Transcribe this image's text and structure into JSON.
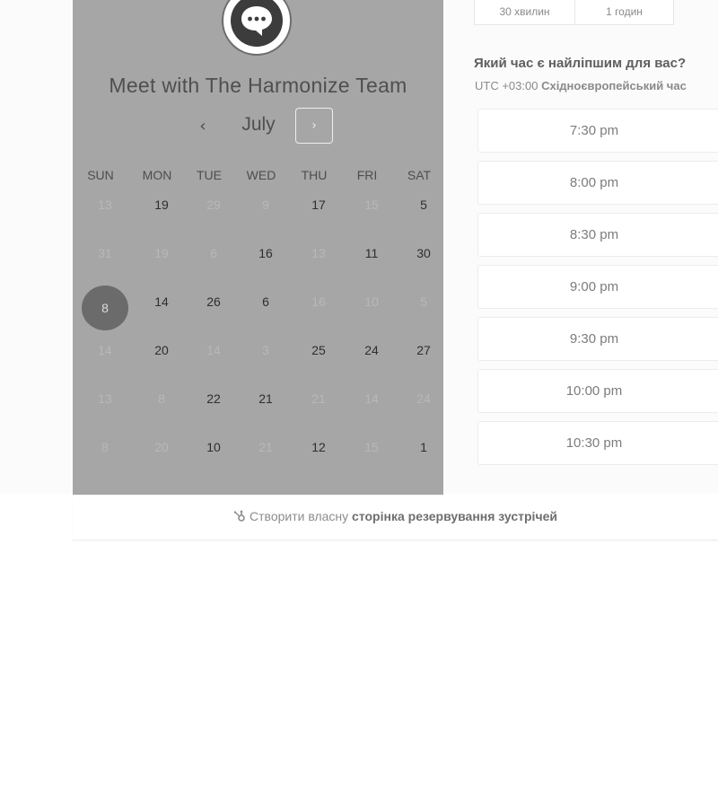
{
  "calendar": {
    "title": "Meet with The Harmonize Team",
    "month": "July",
    "prev_icon": "chevron-left-icon",
    "next_icon": "chevron-right-icon",
    "weekdays": [
      "SUN",
      "MON",
      "TUE",
      "WED",
      "THU",
      "FRI",
      "SAT"
    ],
    "weeks": [
      [
        {
          "d": "13",
          "m": true
        },
        {
          "d": "19",
          "m": false
        },
        {
          "d": "29",
          "m": true
        },
        {
          "d": "9",
          "m": true
        },
        {
          "d": "17",
          "m": false
        },
        {
          "d": "15",
          "m": true
        },
        {
          "d": "5",
          "m": false
        }
      ],
      [
        {
          "d": "31",
          "m": true
        },
        {
          "d": "19",
          "m": true
        },
        {
          "d": "6",
          "m": true
        },
        {
          "d": "16",
          "m": false
        },
        {
          "d": "13",
          "m": true
        },
        {
          "d": "11",
          "m": false
        },
        {
          "d": "30",
          "m": false
        }
      ],
      [
        {
          "d": "8",
          "m": false,
          "sel": true
        },
        {
          "d": "14",
          "m": false
        },
        {
          "d": "26",
          "m": false
        },
        {
          "d": "6",
          "m": false
        },
        {
          "d": "16",
          "m": true
        },
        {
          "d": "10",
          "m": true
        },
        {
          "d": "5",
          "m": true
        }
      ],
      [
        {
          "d": "14",
          "m": true
        },
        {
          "d": "20",
          "m": false
        },
        {
          "d": "14",
          "m": true
        },
        {
          "d": "3",
          "m": true
        },
        {
          "d": "25",
          "m": false
        },
        {
          "d": "24",
          "m": false
        },
        {
          "d": "27",
          "m": false
        }
      ],
      [
        {
          "d": "13",
          "m": true
        },
        {
          "d": "8",
          "m": true
        },
        {
          "d": "22",
          "m": false
        },
        {
          "d": "21",
          "m": false
        },
        {
          "d": "21",
          "m": true
        },
        {
          "d": "14",
          "m": true
        },
        {
          "d": "24",
          "m": true
        }
      ],
      [
        {
          "d": "8",
          "m": true
        },
        {
          "d": "20",
          "m": true
        },
        {
          "d": "10",
          "m": false
        },
        {
          "d": "21",
          "m": true
        },
        {
          "d": "12",
          "m": false
        },
        {
          "d": "15",
          "m": true
        },
        {
          "d": "1",
          "m": false
        }
      ]
    ]
  },
  "durations": [
    "30 хвилин",
    "1 годин"
  ],
  "question": "Який час є найліпшим для вас?",
  "timezone": {
    "offset": "UTC +03:00",
    "name": "Східноєвропейський час"
  },
  "slots": [
    "7:30 pm",
    "8:00 pm",
    "8:30 pm",
    "9:00 pm",
    "9:30 pm",
    "10:00 pm",
    "10:30 pm"
  ],
  "footer": {
    "prefix": "Створити власну",
    "link": "сторінка резервування зустрічей",
    "icon": "hubspot-sprocket-icon"
  }
}
